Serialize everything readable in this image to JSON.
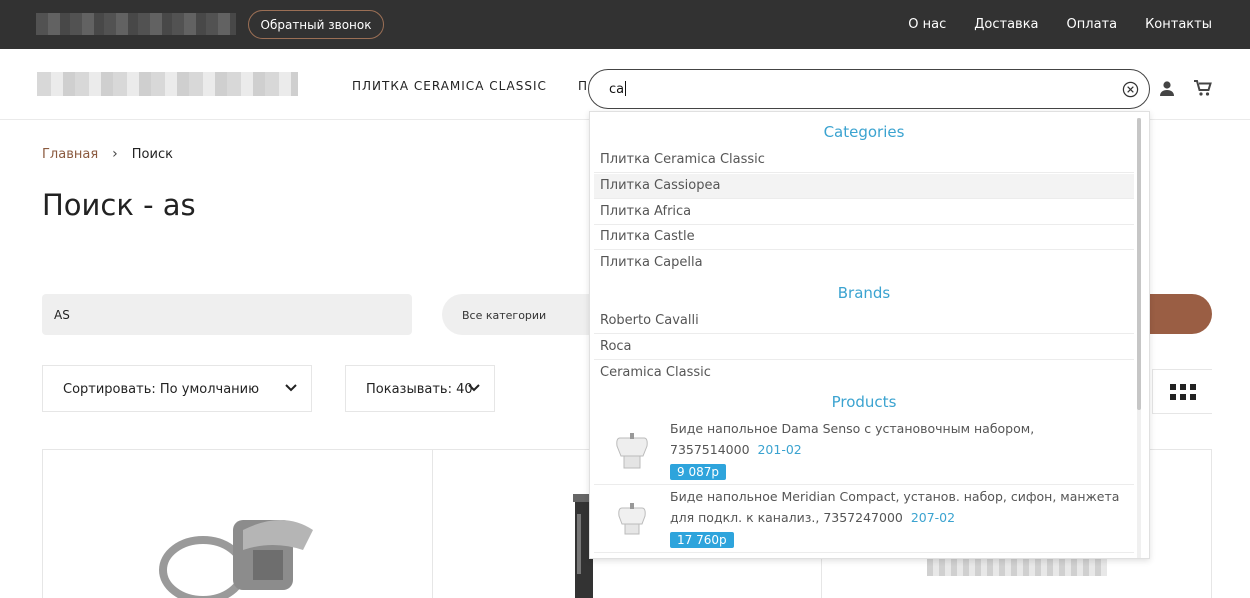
{
  "topbar": {
    "callback_label": "Обратный звонок",
    "nav": [
      "О нас",
      "Доставка",
      "Оплата",
      "Контакты"
    ]
  },
  "header": {
    "menu": [
      "ПЛИТКА CERAMICA CLASSIC",
      "П"
    ]
  },
  "breadcrumb": {
    "home": "Главная",
    "separator": "›",
    "current": "Поиск"
  },
  "page_title": "Поиск - as",
  "search_form": {
    "query_value": "AS",
    "category_value": "Все категории"
  },
  "toolbar": {
    "sort_label": "Сортировать: По умолчанию",
    "show_label": "Показывать: 40"
  },
  "autocomplete": {
    "input_value": "ca",
    "categories_heading": "Categories",
    "categories": [
      "Плитка Ceramica Classic",
      "Плитка Cassiopea",
      "Плитка Africa",
      "Плитка Castle",
      "Плитка Capella"
    ],
    "brands_heading": "Brands",
    "brands": [
      "Roberto Cavalli",
      "Roca",
      "Ceramica Classic"
    ],
    "products_heading": "Products",
    "products": [
      {
        "name": "Биде напольное Dama Senso с установочным набором, 7357514000",
        "code": "201-02",
        "price": "9 087р"
      },
      {
        "name": "Биде напольное Meridian Compact, установ. набор, сифон, манжета для подкл. к канализ., 7357247000",
        "code": "207-02",
        "price": "17 760р"
      }
    ]
  },
  "colors": {
    "topbar_bg": "#323232",
    "accent_brown": "#9a5e44",
    "link_blue": "#3ba3d0",
    "price_bg": "#2ea4dc"
  }
}
